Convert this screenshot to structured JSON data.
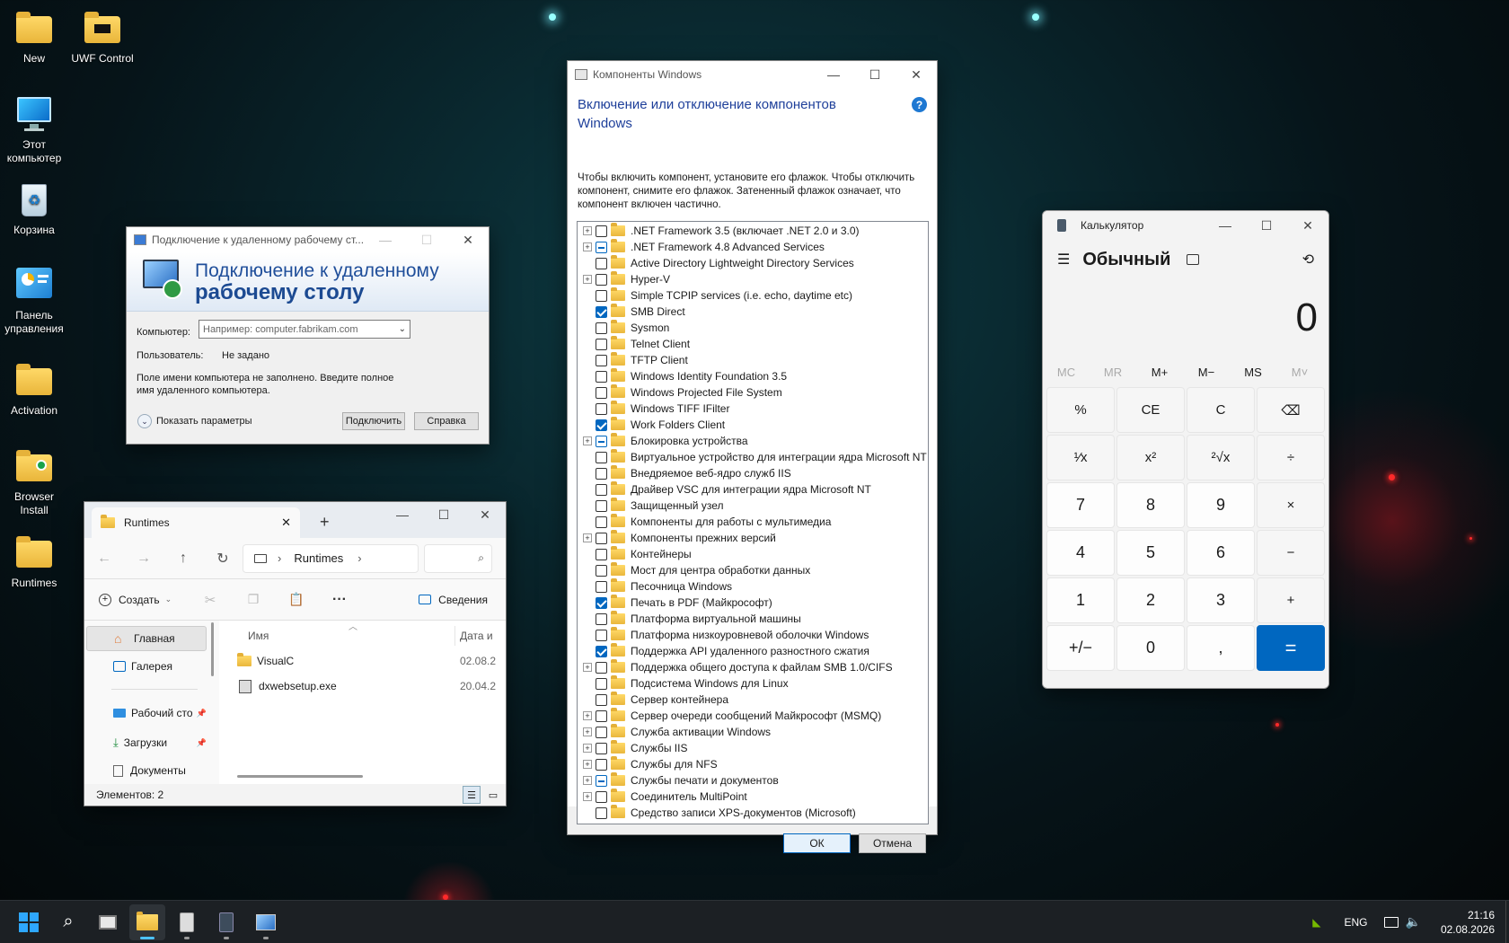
{
  "desktop": {
    "icons": [
      {
        "label": "New",
        "icon": "folder-icon"
      },
      {
        "label": "UWF Control",
        "icon": "folder-icon"
      },
      {
        "label": "Этот компьютер",
        "icon": "computer-icon"
      },
      {
        "label": "Корзина",
        "icon": "recycle-bin-icon"
      },
      {
        "label": "Панель управления",
        "icon": "control-panel-icon"
      },
      {
        "label": "Activation",
        "icon": "folder-icon"
      },
      {
        "label": "Browser Install",
        "icon": "folder-icon"
      },
      {
        "label": "Runtimes",
        "icon": "folder-icon"
      }
    ]
  },
  "rdp": {
    "title": "Подключение к удаленному рабочему ст...",
    "banner_line1": "Подключение к удаленному",
    "banner_line2": "рабочему столу",
    "computer_label": "Компьютер:",
    "computer_placeholder": "Например: computer.fabrikam.com",
    "user_label": "Пользователь:",
    "user_value": "Не задано",
    "info": "Поле имени компьютера не заполнено. Введите полное имя удаленного компьютера.",
    "show_options": "Показать параметры",
    "connect": "Подключить",
    "help": "Справка"
  },
  "explorer": {
    "tab_title": "Runtimes",
    "breadcrumb": "Runtimes",
    "create": "Создать",
    "details": "Сведения",
    "nav": [
      "Главная",
      "Галерея",
      "Рабочий сто",
      "Загрузки",
      "Документы"
    ],
    "col_name": "Имя",
    "col_date": "Дата и",
    "files": [
      {
        "name": "VisualC",
        "date": "02.08.2"
      },
      {
        "name": "dxwebsetup.exe",
        "date": "20.04.2"
      }
    ],
    "status": "Элементов: 2"
  },
  "features": {
    "title": "Компоненты Windows",
    "heading": "Включение или отключение компонентов Windows",
    "description": "Чтобы включить компонент, установите его флажок. Чтобы отключить компонент, снимите его флажок. Затененный флажок означает, что компонент включен частично.",
    "items": [
      {
        "label": ".NET Framework 3.5 (включает .NET 2.0 и 3.0)",
        "state": "off",
        "expand": true
      },
      {
        "label": ".NET Framework 4.8 Advanced Services",
        "state": "partial",
        "expand": true
      },
      {
        "label": "Active Directory Lightweight Directory Services",
        "state": "off",
        "expand": false
      },
      {
        "label": "Hyper-V",
        "state": "off",
        "expand": true
      },
      {
        "label": "Simple TCPIP services (i.e. echo, daytime etc)",
        "state": "off",
        "expand": false
      },
      {
        "label": "SMB Direct",
        "state": "on",
        "expand": false
      },
      {
        "label": "Sysmon",
        "state": "off",
        "expand": false
      },
      {
        "label": "Telnet Client",
        "state": "off",
        "expand": false
      },
      {
        "label": "TFTP Client",
        "state": "off",
        "expand": false
      },
      {
        "label": "Windows Identity Foundation 3.5",
        "state": "off",
        "expand": false
      },
      {
        "label": "Windows Projected File System",
        "state": "off",
        "expand": false
      },
      {
        "label": "Windows TIFF IFilter",
        "state": "off",
        "expand": false
      },
      {
        "label": "Work Folders Client",
        "state": "on",
        "expand": false
      },
      {
        "label": "Блокировка устройства",
        "state": "partial",
        "expand": true
      },
      {
        "label": "Виртуальное устройство для интеграции ядра Microsoft NT",
        "state": "off",
        "expand": false
      },
      {
        "label": "Внедряемое веб-ядро служб IIS",
        "state": "off",
        "expand": false
      },
      {
        "label": "Драйвер VSC для интеграции ядра Microsoft NT",
        "state": "off",
        "expand": false
      },
      {
        "label": "Защищенный узел",
        "state": "off",
        "expand": false
      },
      {
        "label": "Компоненты для работы с мультимедиа",
        "state": "off",
        "expand": false
      },
      {
        "label": "Компоненты прежних версий",
        "state": "off",
        "expand": true
      },
      {
        "label": "Контейнеры",
        "state": "off",
        "expand": false
      },
      {
        "label": "Мост для центра обработки данных",
        "state": "off",
        "expand": false
      },
      {
        "label": "Песочница Windows",
        "state": "off",
        "expand": false
      },
      {
        "label": "Печать в PDF (Майкрософт)",
        "state": "on",
        "expand": false
      },
      {
        "label": "Платформа виртуальной машины",
        "state": "off",
        "expand": false
      },
      {
        "label": "Платформа низкоуровневой оболочки Windows",
        "state": "off",
        "expand": false
      },
      {
        "label": "Поддержка API удаленного разностного сжатия",
        "state": "on",
        "expand": false
      },
      {
        "label": "Поддержка общего доступа к файлам SMB 1.0/CIFS",
        "state": "off",
        "expand": true
      },
      {
        "label": "Подсистема Windows для Linux",
        "state": "off",
        "expand": false
      },
      {
        "label": "Сервер контейнера",
        "state": "off",
        "expand": false
      },
      {
        "label": "Сервер очереди сообщений Майкрософт (MSMQ)",
        "state": "off",
        "expand": true
      },
      {
        "label": "Служба активации Windows",
        "state": "off",
        "expand": true
      },
      {
        "label": "Службы IIS",
        "state": "off",
        "expand": true
      },
      {
        "label": "Службы для NFS",
        "state": "off",
        "expand": true
      },
      {
        "label": "Службы печати и документов",
        "state": "partial",
        "expand": true
      },
      {
        "label": "Соединитель MultiPoint",
        "state": "off",
        "expand": true
      },
      {
        "label": "Средство записи XPS-документов (Microsoft)",
        "state": "off",
        "expand": false
      }
    ],
    "ok": "ОК",
    "cancel": "Отмена"
  },
  "calc": {
    "title": "Калькулятор",
    "mode": "Обычный",
    "display": "0",
    "memory": [
      "MC",
      "MR",
      "M+",
      "M−",
      "MS",
      "M˅"
    ],
    "keys": [
      "%",
      "CE",
      "C",
      "⌫",
      "¹⁄x",
      "x²",
      "²√x",
      "÷",
      "7",
      "8",
      "9",
      "×",
      "4",
      "5",
      "6",
      "−",
      "1",
      "2",
      "3",
      "+",
      "+/−",
      "0",
      ",",
      "="
    ]
  },
  "taskbar": {
    "lang": "ENG",
    "time": "21:16",
    "date": "02.08.2026"
  },
  "colors": {
    "accent": "#0067c0",
    "title_blue": "#003399"
  }
}
